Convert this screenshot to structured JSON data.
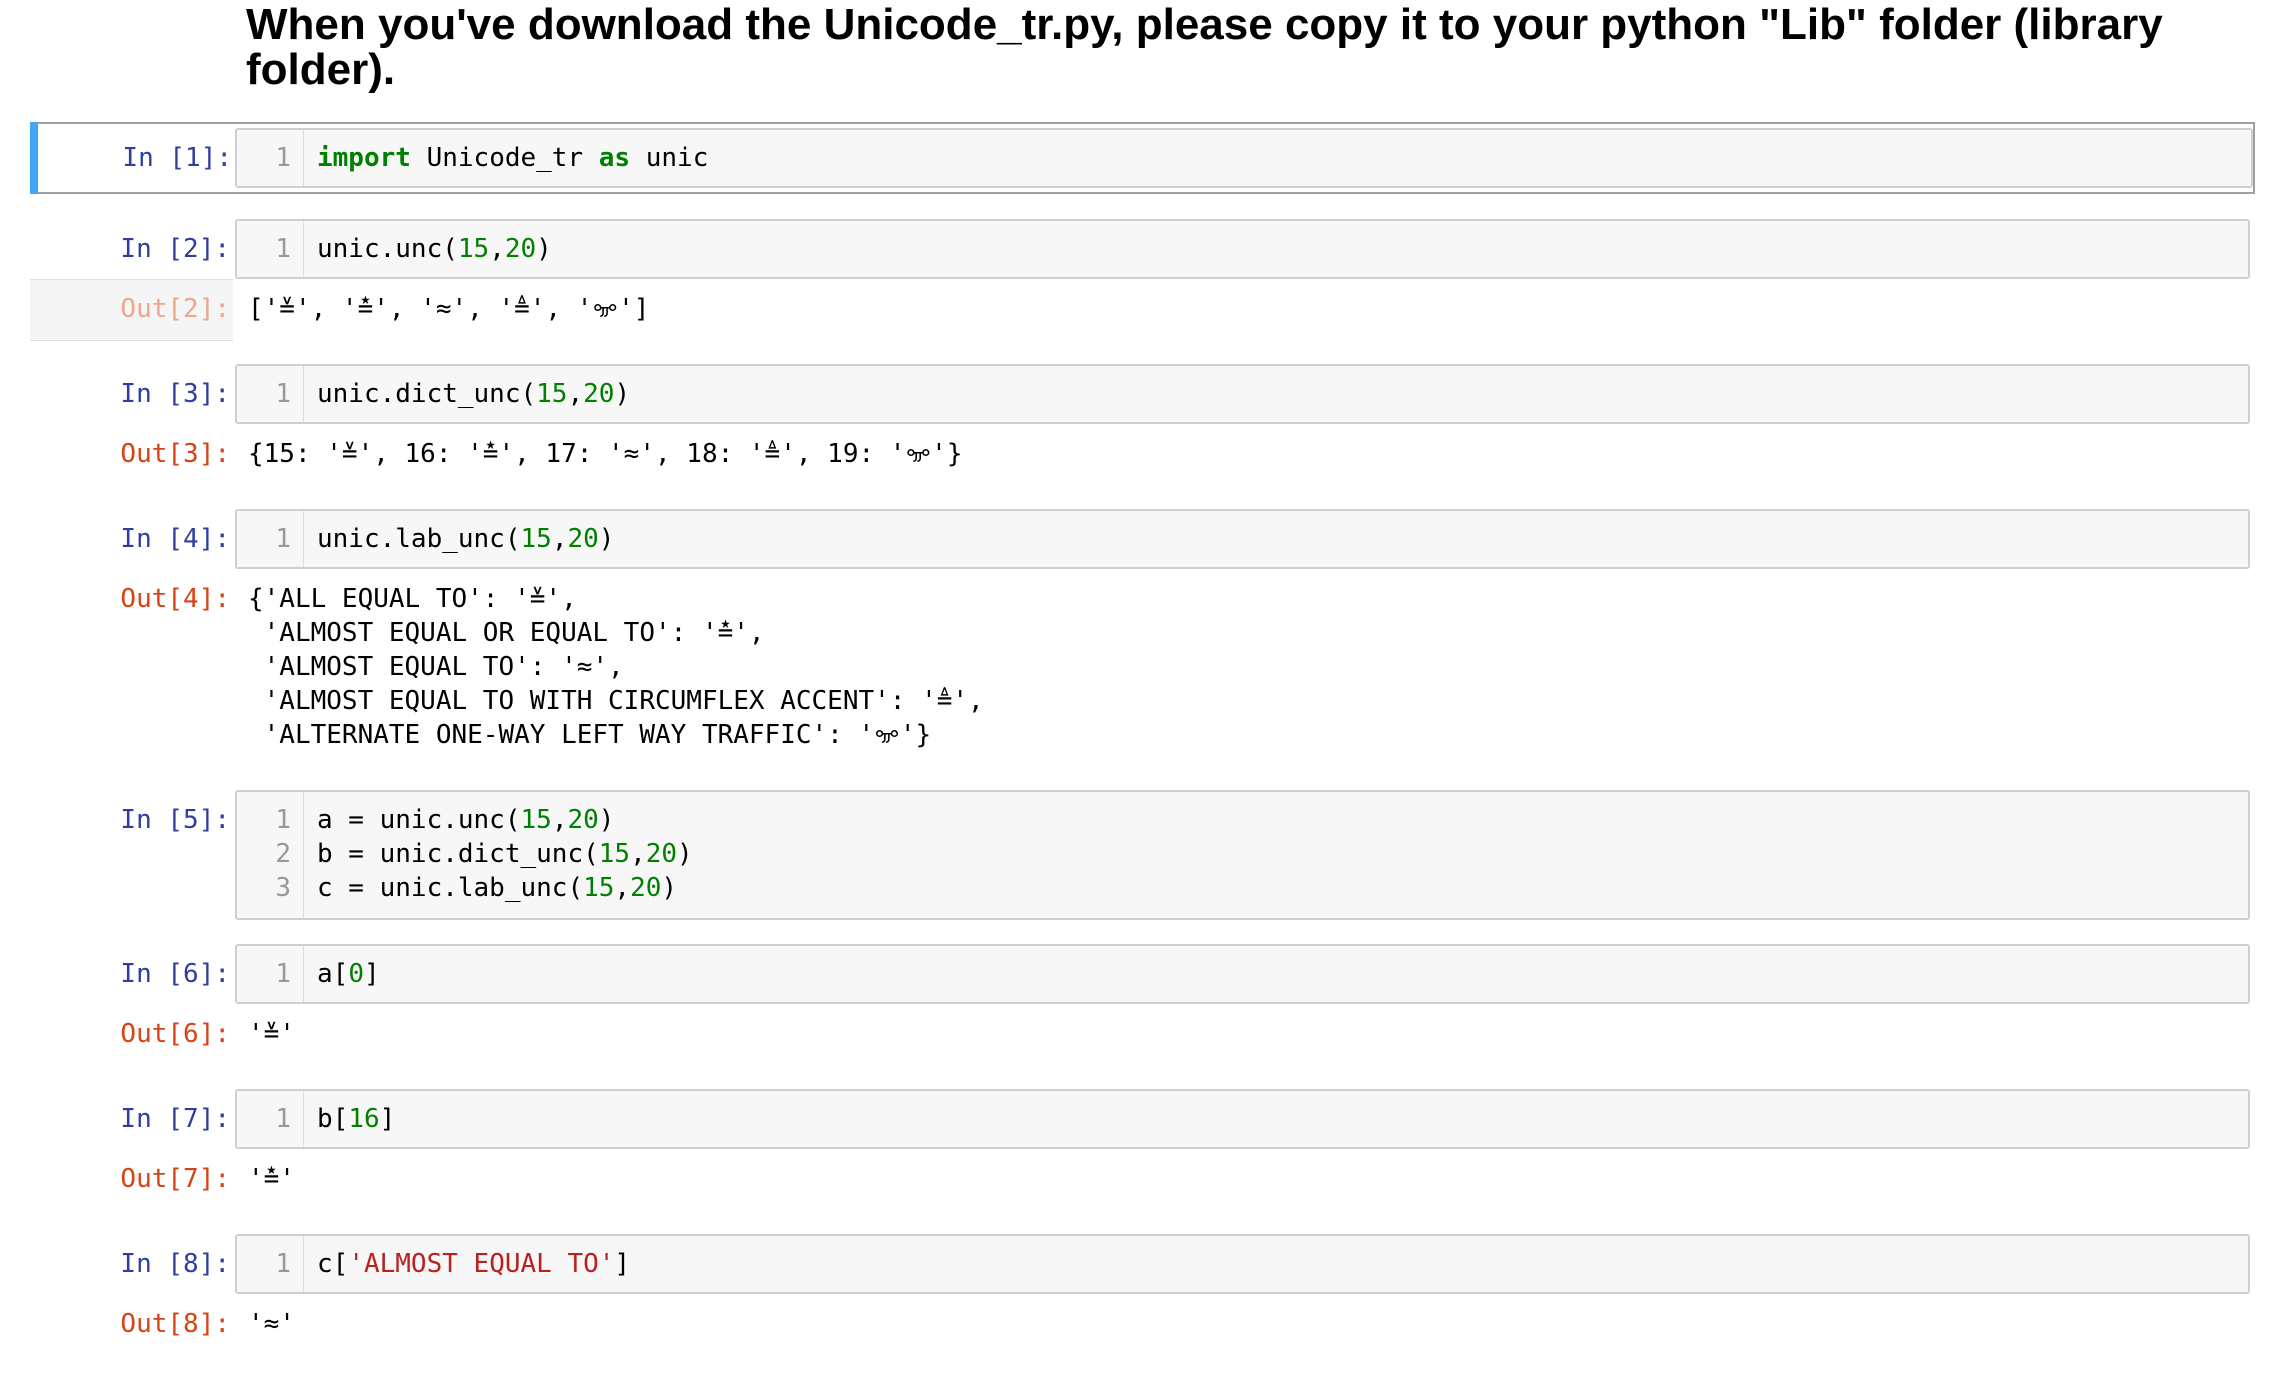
{
  "heading": "When you've download the Unicode_tr.py, please copy it to your python \"Lib\" folder (library folder).",
  "cells": [
    {
      "in_prompt": "In [1]:",
      "lines": [
        {
          "no": "1",
          "tokens": [
            {
              "t": "import",
              "c": "kw"
            },
            {
              "t": " Unicode_tr ",
              "c": ""
            },
            {
              "t": "as",
              "c": "kw"
            },
            {
              "t": " unic",
              "c": ""
            }
          ]
        }
      ],
      "out_prompt": "",
      "output": []
    },
    {
      "in_prompt": "In [2]:",
      "lines": [
        {
          "no": "1",
          "tokens": [
            {
              "t": "unic.unc(",
              "c": ""
            },
            {
              "t": "15",
              "c": "num"
            },
            {
              "t": ",",
              "c": ""
            },
            {
              "t": "20",
              "c": "num"
            },
            {
              "t": ")",
              "c": ""
            }
          ]
        }
      ],
      "out_prompt": "Out[2]:",
      "output": [
        "['≚', '≛', '≈', '≜', 'ꗁ']"
      ]
    },
    {
      "in_prompt": "In [3]:",
      "lines": [
        {
          "no": "1",
          "tokens": [
            {
              "t": "unic.dict_unc(",
              "c": ""
            },
            {
              "t": "15",
              "c": "num"
            },
            {
              "t": ",",
              "c": ""
            },
            {
              "t": "20",
              "c": "num"
            },
            {
              "t": ")",
              "c": ""
            }
          ]
        }
      ],
      "out_prompt": "Out[3]:",
      "output": [
        "{15: '≚', 16: '≛', 17: '≈', 18: '≜', 19: 'ꗁ'}"
      ]
    },
    {
      "in_prompt": "In [4]:",
      "lines": [
        {
          "no": "1",
          "tokens": [
            {
              "t": "unic.lab_unc(",
              "c": ""
            },
            {
              "t": "15",
              "c": "num"
            },
            {
              "t": ",",
              "c": ""
            },
            {
              "t": "20",
              "c": "num"
            },
            {
              "t": ")",
              "c": ""
            }
          ]
        }
      ],
      "out_prompt": "Out[4]:",
      "output": [
        "{'ALL EQUAL TO': '≚',",
        " 'ALMOST EQUAL OR EQUAL TO': '≛',",
        " 'ALMOST EQUAL TO': '≈',",
        " 'ALMOST EQUAL TO WITH CIRCUMFLEX ACCENT': '≜',",
        " 'ALTERNATE ONE-WAY LEFT WAY TRAFFIC': 'ꗁ'}"
      ]
    },
    {
      "in_prompt": "In [5]:",
      "lines": [
        {
          "no": "1",
          "tokens": [
            {
              "t": "a = unic.unc(",
              "c": ""
            },
            {
              "t": "15",
              "c": "num"
            },
            {
              "t": ",",
              "c": ""
            },
            {
              "t": "20",
              "c": "num"
            },
            {
              "t": ")",
              "c": ""
            }
          ]
        },
        {
          "no": "2",
          "tokens": [
            {
              "t": "b = unic.dict_unc(",
              "c": ""
            },
            {
              "t": "15",
              "c": "num"
            },
            {
              "t": ",",
              "c": ""
            },
            {
              "t": "20",
              "c": "num"
            },
            {
              "t": ")",
              "c": ""
            }
          ]
        },
        {
          "no": "3",
          "tokens": [
            {
              "t": "c = unic.lab_unc(",
              "c": ""
            },
            {
              "t": "15",
              "c": "num"
            },
            {
              "t": ",",
              "c": ""
            },
            {
              "t": "20",
              "c": "num"
            },
            {
              "t": ")",
              "c": ""
            }
          ]
        }
      ],
      "out_prompt": "",
      "output": []
    },
    {
      "in_prompt": "In [6]:",
      "lines": [
        {
          "no": "1",
          "tokens": [
            {
              "t": "a[",
              "c": ""
            },
            {
              "t": "0",
              "c": "num"
            },
            {
              "t": "]",
              "c": ""
            }
          ]
        }
      ],
      "out_prompt": "Out[6]:",
      "output": [
        "'≚'"
      ]
    },
    {
      "in_prompt": "In [7]:",
      "lines": [
        {
          "no": "1",
          "tokens": [
            {
              "t": "b[",
              "c": ""
            },
            {
              "t": "16",
              "c": "num"
            },
            {
              "t": "]",
              "c": ""
            }
          ]
        }
      ],
      "out_prompt": "Out[7]:",
      "output": [
        "'≛'"
      ]
    },
    {
      "in_prompt": "In [8]:",
      "lines": [
        {
          "no": "1",
          "tokens": [
            {
              "t": "c[",
              "c": ""
            },
            {
              "t": "'ALMOST EQUAL TO'",
              "c": "str"
            },
            {
              "t": "]",
              "c": ""
            }
          ]
        }
      ],
      "out_prompt": "Out[8]:",
      "output": [
        "'≈'"
      ]
    }
  ]
}
